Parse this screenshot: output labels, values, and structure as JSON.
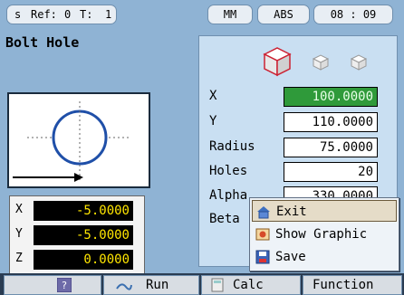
{
  "status": {
    "mode": "s",
    "ref_label": "Ref:",
    "ref_value": "0",
    "tool_label": "T:",
    "tool_value": "1",
    "units": "MM",
    "coord": "ABS",
    "time": "08 : 09"
  },
  "page_title": "Bolt Hole",
  "form": {
    "x_label": "X",
    "x_value": "100.0000",
    "y_label": "Y",
    "y_value": "110.0000",
    "radius_label": "Radius",
    "radius_value": "75.0000",
    "holes_label": "Holes",
    "holes_value": "20",
    "alpha_label": "Alpha",
    "alpha_value": "330.0000",
    "beta_label": "Beta"
  },
  "dro": [
    {
      "axis": "X",
      "value": "-5.0000"
    },
    {
      "axis": "Y",
      "value": "-5.0000"
    },
    {
      "axis": "Z",
      "value": "0.0000"
    }
  ],
  "menu": {
    "items": [
      {
        "label": "Exit",
        "icon": "exit-icon",
        "selected": true
      },
      {
        "label": "Show Graphic",
        "icon": "show-graphic-icon",
        "selected": false
      },
      {
        "label": "Save",
        "icon": "save-icon",
        "selected": false
      }
    ]
  },
  "softkeys": {
    "help_icon": "help-icon",
    "run": "Run",
    "calc": "Calc",
    "function": "Function"
  },
  "colors": {
    "background": "#8fb3d4",
    "panel": "#c9dff2",
    "active_field": "#2f9a3a",
    "dro_text": "#ffe600",
    "softbar": "#2a3c52"
  }
}
